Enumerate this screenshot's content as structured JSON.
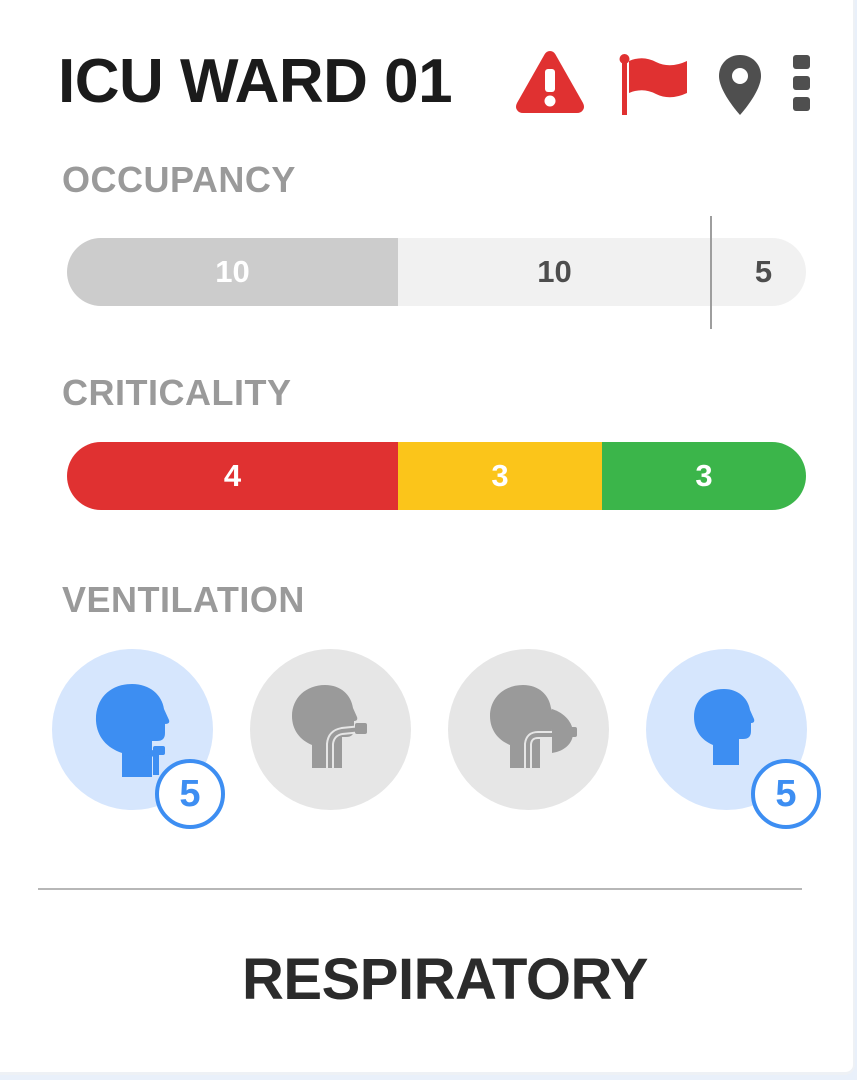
{
  "header": {
    "title": "ICU WARD 01",
    "icons": [
      "warning-icon",
      "flag-icon",
      "location-pin-icon",
      "more-vertical-icon"
    ]
  },
  "occupancy": {
    "label": "OCCUPANCY",
    "segments": [
      {
        "value": "10",
        "color": "#cccccc"
      },
      {
        "value": "10",
        "color": "#f1f1f1"
      },
      {
        "value": "5",
        "color": "#f1f1f1"
      }
    ]
  },
  "criticality": {
    "label": "CRITICALITY",
    "segments": [
      {
        "value": "4",
        "color": "#e03131"
      },
      {
        "value": "3",
        "color": "#fbc51a"
      },
      {
        "value": "3",
        "color": "#3bb54a"
      }
    ]
  },
  "ventilation": {
    "label": "VENTILATION",
    "items": [
      {
        "icon": "tracheostomy-icon",
        "active": true,
        "count": "5"
      },
      {
        "icon": "intubation-icon",
        "active": false,
        "count": null
      },
      {
        "icon": "mask-ventilation-icon",
        "active": false,
        "count": null
      },
      {
        "icon": "spontaneous-breathing-icon",
        "active": true,
        "count": "5"
      }
    ]
  },
  "footer": {
    "label": "RESPIRATORY"
  },
  "colors": {
    "accent_blue": "#3d8ef2",
    "active_circle": "#d6e6fd",
    "inactive_circle": "#e6e6e6",
    "alert_red": "#e03131"
  }
}
